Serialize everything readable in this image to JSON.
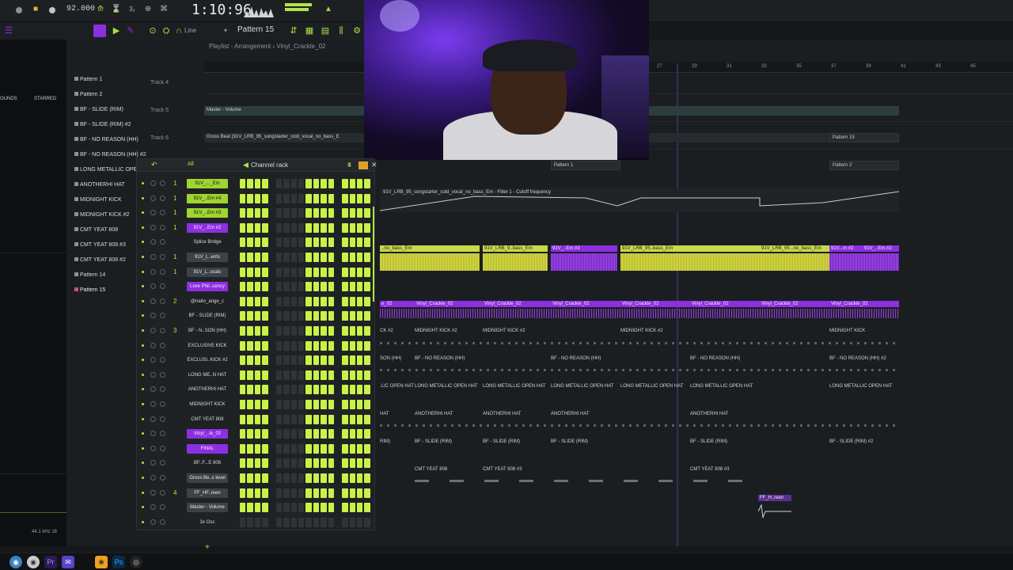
{
  "transport": {
    "tempo": "92.000",
    "time": "1:10:96",
    "pattern": "Pattern 15",
    "snap": "Line"
  },
  "playlist": {
    "title": "Playlist - Arrangement › Vinyl_Crackle_02",
    "ruler": [
      "27",
      "29",
      "31",
      "33",
      "35",
      "37",
      "39",
      "41",
      "43",
      "45"
    ],
    "tracks": [
      "Track 4",
      "Track 5",
      "Track 6"
    ],
    "picker": [
      {
        "label": "Pattern 1"
      },
      {
        "label": "Pattern 2"
      },
      {
        "label": "BF - SLIDE (RIM)"
      },
      {
        "label": "BF - SLIDE (RIM) #2"
      },
      {
        "label": "BF - NO REASON (HH)"
      },
      {
        "label": "BF - NO REASON (HH) #2"
      },
      {
        "label": "LONG METALLIC OPEN H"
      },
      {
        "label": "ANOTHERHI HAT"
      },
      {
        "label": "MIDNIGHT KICK"
      },
      {
        "label": "MIDNIGHT KICK #2"
      },
      {
        "label": "CMT YEAT 808"
      },
      {
        "label": "CMT YEAT 808 #3"
      },
      {
        "label": "CMT YEAT 808 #2"
      },
      {
        "label": "Pattern 14"
      },
      {
        "label": "Pattern 15"
      }
    ],
    "automation_top": "Master - Volume",
    "gross_beat": "Gross Beat (91V_LRB_95_songstarter_cold_vocal_no_bass_E",
    "pattern_clips": {
      "p15": "Pattern 15",
      "p2": "Pattern 2",
      "p1": "Pattern 1"
    },
    "filter_clip": "91V_LRB_95_songstarter_cold_vocal_no_bass_Em - Filter 1 - Cutoff frequency",
    "audio_clips": [
      "..no_bass_Em",
      "91V_LRB_9..bass_Em",
      "91V_..Em #2",
      "91V_LRB_95..bass_Em",
      "91V_LRB_95...no_bass_Em",
      "91V...m #2",
      "91V_..Em #2"
    ],
    "vinyl_clips": [
      "e_02",
      "Vinyl_Crackle_02",
      "Vinyl_Crackle_02",
      "Vinyl_Crackle_02",
      "Vinyl_Crackle_02",
      "Vinyl_Crackle_02",
      "Vinyl_Crackle_02",
      "Vinyl_Crackle_02"
    ],
    "kick_clips": [
      "CK #2",
      "MIDNIGHT KICK #2",
      "MIDNIGHT KICK #2",
      "MIDNIGHT KICK #2",
      "MIDNIGHT KICK"
    ],
    "hh_clips": [
      "SON (HH)",
      "BF - NO REASON (HH)",
      "BF - NO REASON (HH)",
      "BF - NO REASON (HH)",
      "BF - NO REASON (HH) #2"
    ],
    "oh_clips": [
      ".LIC OPEN HAT",
      "LONG METALLIC OPEN HAT",
      "LONG METALLIC OPEN HAT",
      "LONG METALLIC OPEN HAT",
      "LONG METALLIC OPEN HAT",
      "LONG METALLIC OPEN HAT",
      "LONG METALLIC OPEN HAT"
    ],
    "ahh_clips": [
      "HAT",
      "ANOTHERHI HAT",
      "ANOTHERHI HAT",
      "ANOTHERHI HAT",
      "ANOTHERHI HAT"
    ],
    "rim_clips": [
      "RIM)",
      "BF - SLIDE (RIM)",
      "BF - SLIDE (RIM)",
      "BF - SLIDE (RIM)",
      "BF - SLIDE (RIM)",
      "BF - SLIDE (RIM) #2"
    ],
    "yeat_clips": [
      "CMT YEAT 808",
      "CMT YEAT 808 #3",
      "CMT YEAT 808 #3"
    ],
    "ff_clip": "FF_H..reen"
  },
  "browser": {
    "tab_sounds": "OUNDS",
    "tab_starred": "STARRED",
    "sample_rate": "44.1 kHz 16"
  },
  "channel_rack": {
    "title": "Channel rack",
    "filter": "All",
    "channels": [
      {
        "num": "1",
        "name": "91V_..._Em",
        "style": "g",
        "steps": [
          1,
          1,
          1,
          1,
          1,
          1,
          1,
          1
        ]
      },
      {
        "num": "1",
        "name": "91V_..Em #4",
        "style": "g",
        "steps": [
          1,
          1,
          1,
          1,
          1,
          1,
          1,
          1
        ]
      },
      {
        "num": "1",
        "name": "91V_..Em #3",
        "style": "g",
        "steps": [
          1,
          1,
          1,
          1,
          1,
          1,
          1,
          1
        ]
      },
      {
        "num": "1",
        "name": "91V_..Em #2",
        "style": "p",
        "steps": [
          1,
          1,
          1,
          1,
          1,
          1,
          1,
          1
        ]
      },
      {
        "num": "",
        "name": "Splice Bridge",
        "style": "blank",
        "steps": [
          1,
          1,
          1,
          1,
          1,
          1,
          1,
          1
        ]
      },
      {
        "num": "1",
        "name": "91V_L..ents",
        "style": "d",
        "steps": [
          1,
          1,
          1,
          1,
          1,
          1,
          1,
          1
        ]
      },
      {
        "num": "1",
        "name": "91V_L..ocals",
        "style": "d",
        "steps": [
          1,
          1,
          1,
          1,
          1,
          1,
          1,
          1
        ]
      },
      {
        "num": "",
        "name": "Love Phil..uency",
        "style": "p",
        "steps": [
          1,
          1,
          1,
          1,
          1,
          1,
          1,
          1
        ]
      },
      {
        "num": "2",
        "name": "@naito_ange_c",
        "style": "blank",
        "steps": [
          1,
          1,
          1,
          1,
          1,
          1,
          1,
          1
        ]
      },
      {
        "num": "",
        "name": "BF - SLIDE (RIM)",
        "style": "blank",
        "steps": [
          1,
          1,
          1,
          1,
          1,
          1,
          1,
          1
        ]
      },
      {
        "num": "3",
        "name": "BF - N..SON (HH)",
        "style": "blank",
        "steps": [
          1,
          1,
          1,
          1,
          1,
          1,
          1,
          1
        ]
      },
      {
        "num": "",
        "name": "EXCLUSIVE KICK",
        "style": "blank",
        "steps": [
          1,
          1,
          1,
          1,
          1,
          1,
          1,
          1
        ]
      },
      {
        "num": "",
        "name": "EXCLUSI..KICK #2",
        "style": "blank",
        "steps": [
          1,
          1,
          1,
          1,
          1,
          1,
          1,
          1
        ]
      },
      {
        "num": "",
        "name": "LONG ME..N HAT",
        "style": "blank",
        "steps": [
          1,
          1,
          1,
          1,
          1,
          1,
          1,
          1
        ]
      },
      {
        "num": "",
        "name": "ANOTHERHI HAT",
        "style": "blank",
        "steps": [
          1,
          1,
          1,
          1,
          1,
          1,
          1,
          1
        ]
      },
      {
        "num": "",
        "name": "MIDNIGHT KICK",
        "style": "blank",
        "steps": [
          1,
          1,
          1,
          1,
          1,
          1,
          1,
          1
        ]
      },
      {
        "num": "",
        "name": "CMT YEAT 808",
        "style": "blank",
        "steps": [
          1,
          1,
          1,
          1,
          1,
          1,
          1,
          1
        ]
      },
      {
        "num": "",
        "name": "Vinyl_..le_02",
        "style": "p",
        "steps": [
          1,
          1,
          1,
          1,
          1,
          1,
          1,
          1
        ]
      },
      {
        "num": "",
        "name": "FINAL",
        "style": "p",
        "steps": [
          1,
          1,
          1,
          1,
          1,
          1,
          1,
          1
        ]
      },
      {
        "num": "",
        "name": "BF..F...E 808",
        "style": "blank",
        "steps": [
          1,
          1,
          1,
          1,
          1,
          1,
          1,
          1
        ]
      },
      {
        "num": "",
        "name": "Gross Be..x level",
        "style": "d",
        "steps": [
          1,
          1,
          1,
          1,
          1,
          1,
          1,
          1
        ]
      },
      {
        "num": "4",
        "name": "FF_HF..reen",
        "style": "d",
        "steps": [
          1,
          1,
          1,
          1,
          1,
          1,
          1,
          1
        ]
      },
      {
        "num": "",
        "name": "Master - Volume",
        "style": "d",
        "steps": [
          1,
          1,
          1,
          1,
          1,
          1,
          1,
          1
        ]
      },
      {
        "num": "",
        "name": "3x Osc",
        "style": "blank",
        "steps": [
          0,
          0,
          0,
          0,
          0,
          0,
          0,
          0
        ]
      }
    ]
  },
  "icons": {
    "taskbar": [
      "chrome-icon",
      "chrome-alt-icon",
      "premiere-icon",
      "chat-icon",
      "fl-studio-icon",
      "photoshop-icon",
      "app-icon"
    ]
  }
}
